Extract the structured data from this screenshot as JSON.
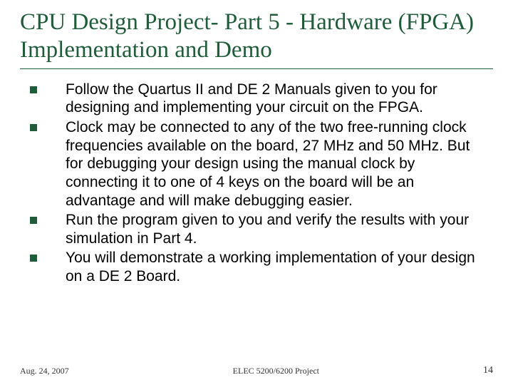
{
  "title": "CPU Design Project- Part 5 - Hardware (FPGA) Implementation and Demo",
  "bullets": [
    "Follow the Quartus II and DE 2 Manuals given to you for designing and implementing your circuit on the FPGA.",
    "Clock may be connected to any of the two free-running clock frequencies available on the board, 27 MHz and 50 MHz. But for debugging your design using the manual clock by connecting it to one of 4 keys on the board will be an advantage and will make debugging easier.",
    "Run the program given to you and verify the results with your simulation in Part 4.",
    "You will demonstrate a working implementation of your design on a DE 2 Board."
  ],
  "footer": {
    "date": "Aug. 24, 2007",
    "center": "ELEC 5200/6200 Project",
    "page": "14"
  }
}
